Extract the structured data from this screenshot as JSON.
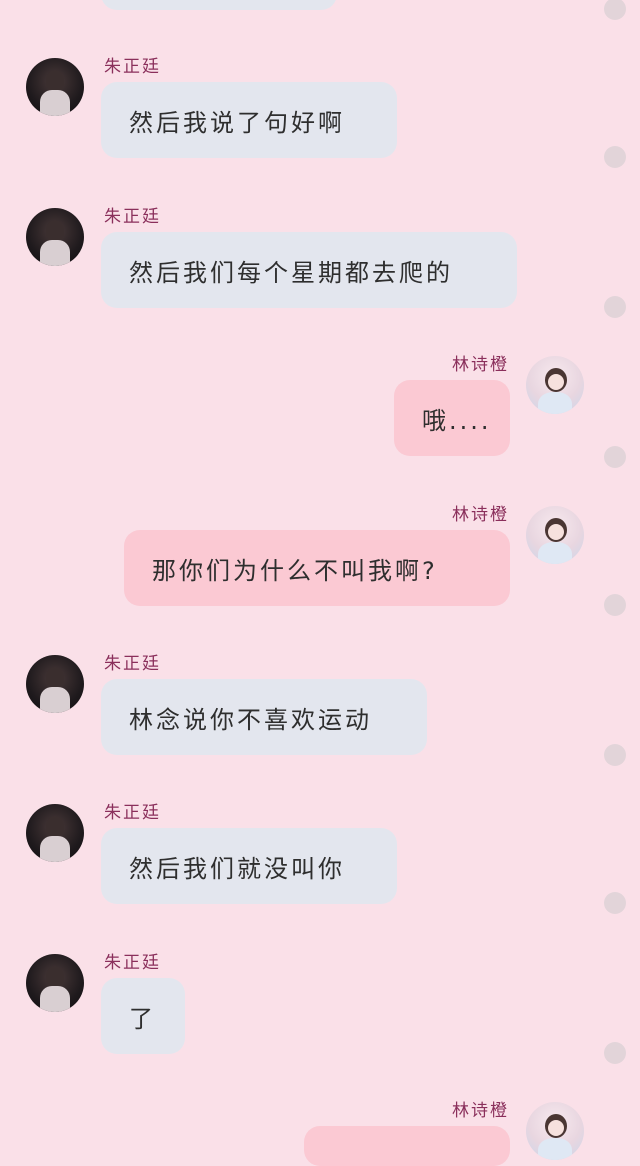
{
  "colors": {
    "background": "#fae0e8",
    "name_color": "#8a2f5b",
    "left_bubble": "#e3e6ee",
    "right_bubble": "#fbc9d3",
    "dot": "#e2d4d9"
  },
  "messages": [
    {
      "sender": "朱正廷",
      "side": "left",
      "text": "然后我说了句好啊"
    },
    {
      "sender": "朱正廷",
      "side": "left",
      "text": "然后我们每个星期都去爬的"
    },
    {
      "sender": "林诗橙",
      "side": "right",
      "text": "哦...."
    },
    {
      "sender": "林诗橙",
      "side": "right",
      "text": "那你们为什么不叫我啊?"
    },
    {
      "sender": "朱正廷",
      "side": "left",
      "text": "林念说你不喜欢运动"
    },
    {
      "sender": "朱正廷",
      "side": "left",
      "text": "然后我们就没叫你"
    },
    {
      "sender": "朱正廷",
      "side": "left",
      "text": "了"
    },
    {
      "sender": "林诗橙",
      "side": "right",
      "text": ""
    }
  ],
  "avatars": {
    "left": "avatar-photo-boy",
    "right": "avatar-photo-girl"
  }
}
